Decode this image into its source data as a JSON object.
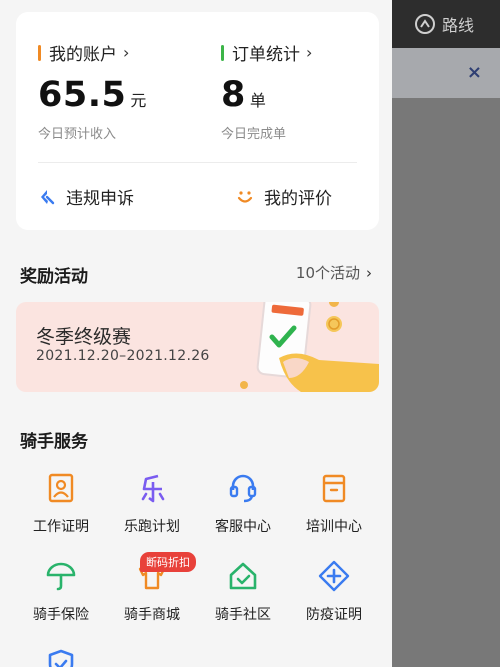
{
  "overlay": {
    "route_label": "路线",
    "close_icon": "×"
  },
  "account": {
    "title": "我的账户",
    "value": "65.5",
    "unit": "元",
    "caption": "今日预计收入",
    "accent": "#f08a24"
  },
  "orders": {
    "title": "订单统计",
    "value": "8",
    "unit": "单",
    "caption": "今日完成单",
    "accent": "#3cb548"
  },
  "actions": {
    "appeal": "违规申诉",
    "reviews": "我的评价"
  },
  "rewards": {
    "title": "奖励活动",
    "more": "10个活动",
    "banner_title": "冬季终级赛",
    "banner_date": "2021.12.20–2021.12.26"
  },
  "services": {
    "title": "骑手服务",
    "items": [
      {
        "label": "工作证明",
        "icon": "id-card-icon",
        "color": "#f08a24"
      },
      {
        "label": "乐跑计划",
        "icon": "le-run-icon",
        "color": "#7a5cf0"
      },
      {
        "label": "客服中心",
        "icon": "headset-icon",
        "color": "#3a7bf0"
      },
      {
        "label": "培训中心",
        "icon": "training-box-icon",
        "color": "#f08a24"
      },
      {
        "label": "骑手保险",
        "icon": "umbrella-icon",
        "color": "#29b36b"
      },
      {
        "label": "骑手商城",
        "icon": "shirt-icon",
        "color": "#f08a24"
      },
      {
        "label": "骑手社区",
        "icon": "home-icon",
        "color": "#29b36b"
      },
      {
        "label": "防疫证明",
        "icon": "plus-diamond-icon",
        "color": "#3a7bf0"
      },
      {
        "label": "",
        "icon": "shield-icon",
        "color": "#3a7bf0"
      }
    ],
    "badge": "断码折扣"
  },
  "chevron": "›"
}
